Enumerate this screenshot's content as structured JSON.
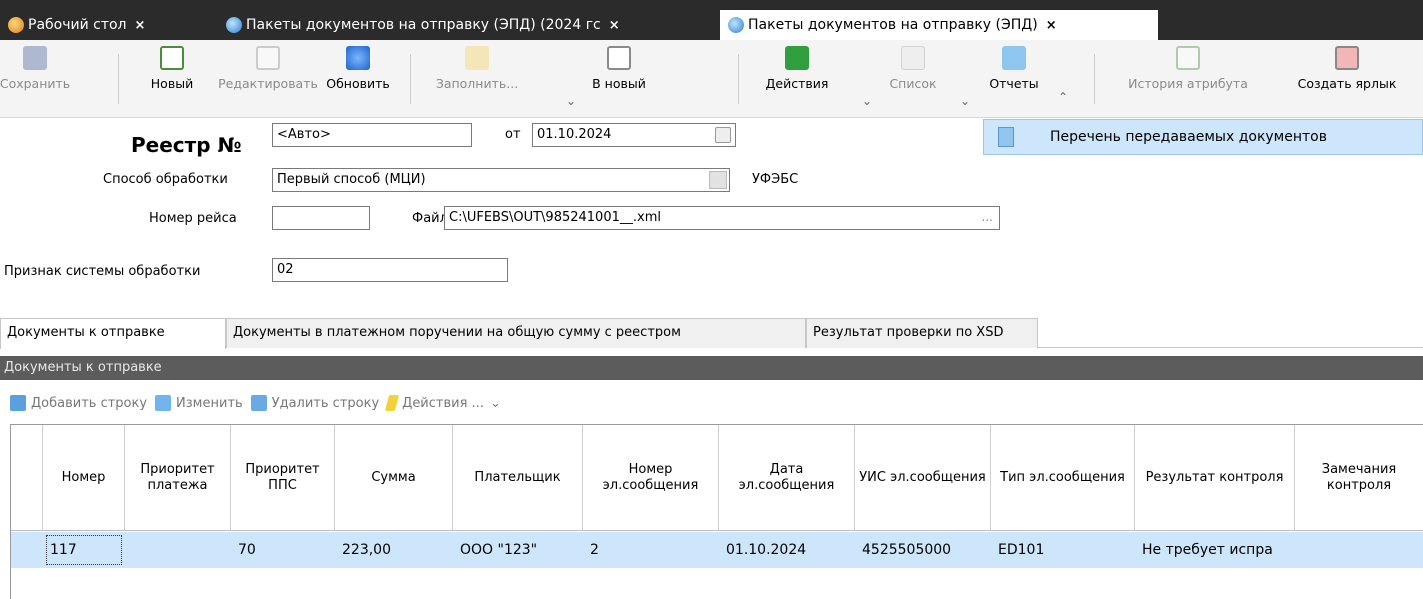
{
  "tabs": [
    {
      "label": "Рабочий стол",
      "close": "×"
    },
    {
      "label": "Пакеты документов на отправку (ЭПД) (2024 гс",
      "close": "×"
    },
    {
      "label": "Пакеты документов на отправку (ЭПД)",
      "close": "×"
    }
  ],
  "toolbar": {
    "save": "Сохранить",
    "new": "Новый",
    "edit": "Редактировать",
    "refresh": "Обновить",
    "fill": "Заполнить...",
    "to_new": "В новый",
    "actions": "Действия",
    "list": "Список",
    "reports": "Отчеты",
    "history": "История атрибута",
    "shortcut": "Создать ярлык"
  },
  "reports_menu": {
    "item1": "Перечень передаваемых документов"
  },
  "form": {
    "registry_label": "Реестр №",
    "registry_value": "<Авто>",
    "from_label": "от",
    "date_value": "01.10.2024",
    "method_label": "Способ обработки",
    "method_value": "Первый способ (МЦИ)",
    "ufebs": "УФЭБС",
    "flight_label": "Номер рейса",
    "flight_value": "",
    "file_label": "Файл",
    "file_value": "C:\\UFEBS\\OUT\\985241001__.xml",
    "system_label": "Признак системы обработки",
    "system_value": "02"
  },
  "inner_tabs": [
    "Документы к отправке",
    "Документы в платежном поручении на общую сумму с реестром",
    "Результат проверки по XSD"
  ],
  "section_title": "Документы к отправке",
  "subtoolbar": {
    "add": "Добавить строку",
    "edit": "Изменить",
    "delete": "Удалить строку",
    "actions": "Действия ..."
  },
  "table": {
    "columns": [
      "Номер",
      "Приоритет платежа",
      "Приоритет ППС",
      "Сумма",
      "Плательщик",
      "Номер эл.сообщения",
      "Дата эл.сообщения",
      "УИС эл.сообщения",
      "Тип эл.сообщения",
      "Результат контроля",
      "Замечания контроля"
    ],
    "rows": [
      [
        "117",
        "",
        "70",
        "223,00",
        "ООО \"123\"",
        "2",
        "01.10.2024",
        "4525505000",
        "ED101",
        "Не требует испра",
        ""
      ]
    ]
  }
}
